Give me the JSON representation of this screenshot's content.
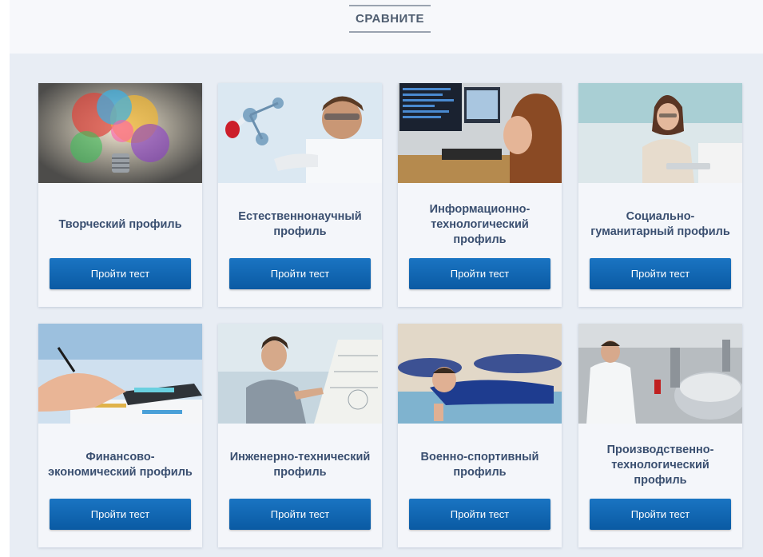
{
  "header": {
    "compare_label": "СРАВНИТЕ"
  },
  "profiles": [
    {
      "title": "Творческий профиль",
      "button_label": "Пройти тест",
      "icon": "colorful-lightbulb-photo"
    },
    {
      "title": "Естественнонаучный профиль",
      "button_label": "Пройти тест",
      "icon": "lab-scientist-photo"
    },
    {
      "title": "Информационно-технологический профиль",
      "button_label": "Пройти тест",
      "icon": "computer-workstation-photo"
    },
    {
      "title": "Социально-гуманитарный профиль",
      "button_label": "Пройти тест",
      "icon": "woman-with-tablet-photo"
    },
    {
      "title": "Финансово-экономический профиль",
      "button_label": "Пройти тест",
      "icon": "calculator-photo"
    },
    {
      "title": "Инженерно-технический профиль",
      "button_label": "Пройти тест",
      "icon": "engineer-drawing-photo"
    },
    {
      "title": "Военно-спортивный профиль",
      "button_label": "Пройти тест",
      "icon": "pushups-photo"
    },
    {
      "title": "Производственно-технологический профиль",
      "button_label": "Пройти тест",
      "icon": "factory-worker-photo"
    }
  ],
  "colors": {
    "button": "#0a62ad",
    "title_text": "#3a4f70",
    "background": "#e8edf4"
  }
}
